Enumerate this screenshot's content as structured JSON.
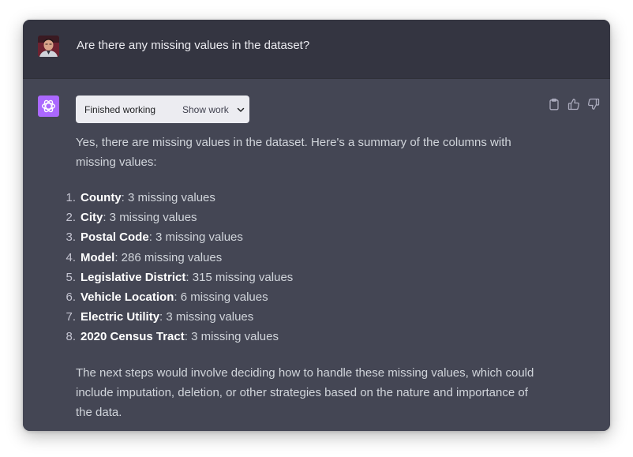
{
  "user_message": {
    "text": "Are there any missing values in the dataset?"
  },
  "assistant_message": {
    "work_status": "Finished working",
    "show_work_label": "Show work",
    "intro": "Yes, there are missing values in the dataset. Here's a summary of the columns with missing values:",
    "items": [
      {
        "number": "1.",
        "name": "County",
        "detail": ": 3 missing values"
      },
      {
        "number": "2.",
        "name": "City",
        "detail": ": 3 missing values"
      },
      {
        "number": "3.",
        "name": "Postal Code",
        "detail": ": 3 missing values"
      },
      {
        "number": "4.",
        "name": "Model",
        "detail": ": 286 missing values"
      },
      {
        "number": "5.",
        "name": "Legislative District",
        "detail": ": 315 missing values"
      },
      {
        "number": "6.",
        "name": "Vehicle Location",
        "detail": ": 6 missing values"
      },
      {
        "number": "7.",
        "name": "Electric Utility",
        "detail": ": 3 missing values"
      },
      {
        "number": "8.",
        "name": "2020 Census Tract",
        "detail": ": 3 missing values"
      }
    ],
    "conclusion": "The next steps would involve deciding how to handle these missing values, which could include imputation, deletion, or other strategies based on the nature and importance of the data."
  },
  "icons": {
    "copy": "clipboard-icon",
    "like": "thumbs-up-icon",
    "dislike": "thumbs-down-icon",
    "expand": "chevron-down-icon",
    "assistant_logo": "openai-logo-icon"
  },
  "colors": {
    "user_bg": "#343541",
    "assistant_bg": "#444654",
    "assistant_avatar": "#ab68ff",
    "text": "#d1d5db",
    "work_box_bg": "#ececf1"
  }
}
